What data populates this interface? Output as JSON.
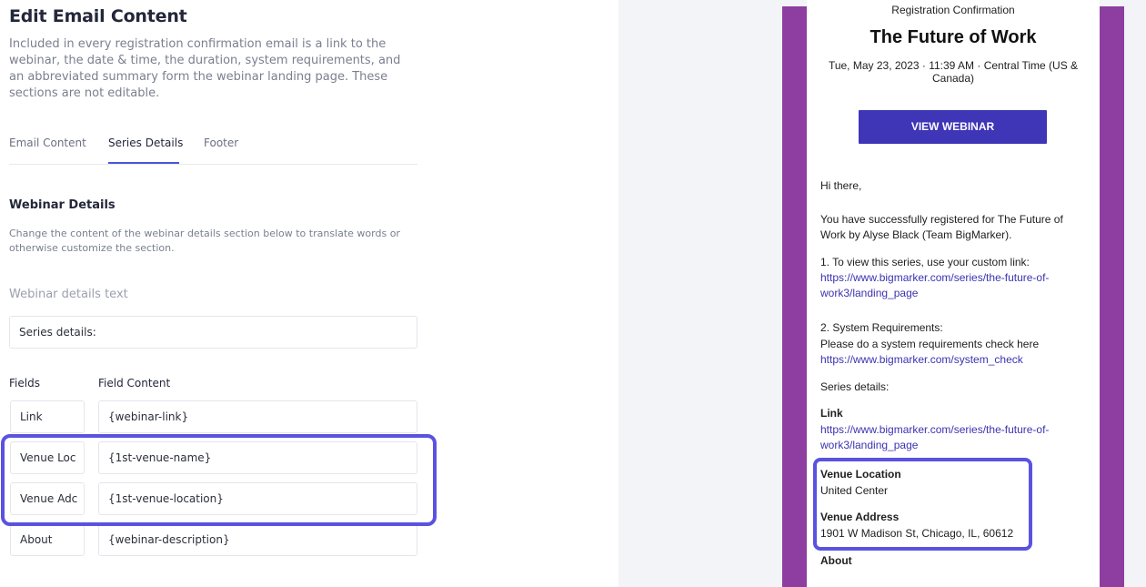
{
  "editor": {
    "title": "Edit Email Content",
    "intro": "Included in every registration confirmation email is a link to the webinar, the date & time, the duration, system requirements, and an abbreviated summary form the webinar landing page. These sections are not editable.",
    "tabs": [
      {
        "label": "Email Content",
        "active": false
      },
      {
        "label": "Series Details",
        "active": true
      },
      {
        "label": "Footer",
        "active": false
      }
    ],
    "section_title": "Webinar Details",
    "section_desc": "Change the content of the webinar details section below to translate words or otherwise customize the section.",
    "details_label": "Webinar details text",
    "details_value": "Series details:",
    "col_fields": "Fields",
    "col_content": "Field Content",
    "rows": [
      {
        "name": "Link",
        "content": "{webinar-link}"
      },
      {
        "name": "Venue Loc",
        "content": "{1st-venue-name}"
      },
      {
        "name": "Venue Adc",
        "content": "{1st-venue-location}"
      },
      {
        "name": "About",
        "content": "{webinar-description}"
      }
    ],
    "highlight_color": "#5a52e0"
  },
  "email": {
    "header": "Registration Confirmation",
    "title": "The Future of Work",
    "datetime": "Tue, May 23, 2023 · 11:39 AM · Central Time (US & Canada)",
    "button": "VIEW WEBINAR",
    "greeting": "Hi there,",
    "registered": "You have successfully registered for The Future of Work by Alyse Black (Team BigMarker).",
    "step1": "1. To view this series, use your custom link:",
    "step1_link": "https://www.bigmarker.com/series/the-future-of-work3/landing_page",
    "step2": "2. System Requirements:",
    "step2_text": "Please do a system requirements check here",
    "step2_link": "https://www.bigmarker.com/system_check",
    "series_details": "Series details:",
    "link_label": "Link",
    "link_value": "https://www.bigmarker.com/series/the-future-of-work3/landing_page",
    "venue_location_label": "Venue Location",
    "venue_location_value": "United Center",
    "venue_address_label": "Venue Address",
    "venue_address_value": "1901 W Madison St, Chicago, IL, 60612",
    "about_label": "About",
    "accent_purple": "#8e3ea0",
    "button_color": "#3e35b7",
    "link_color": "#3b33b0"
  }
}
